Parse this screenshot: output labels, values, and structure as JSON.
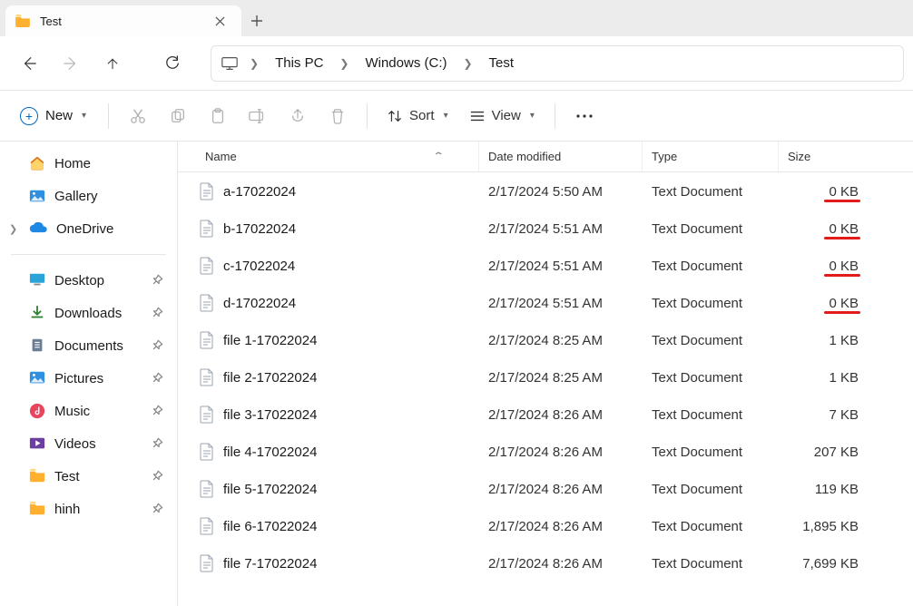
{
  "tab": {
    "title": "Test",
    "close_tooltip": "Close",
    "new_tooltip": "New tab"
  },
  "nav": {
    "back": "Back",
    "forward": "Forward",
    "up": "Up",
    "refresh": "Refresh",
    "breadcrumbs": [
      "This PC",
      "Windows (C:)",
      "Test"
    ]
  },
  "toolbar": {
    "new_label": "New",
    "sort_label": "Sort",
    "view_label": "View",
    "actions": {
      "cut": "Cut",
      "copy": "Copy",
      "paste": "Paste",
      "rename": "Rename",
      "share": "Share",
      "delete": "Delete",
      "more": "More"
    }
  },
  "sidebar": {
    "top": [
      {
        "label": "Home",
        "icon": "home-icon"
      },
      {
        "label": "Gallery",
        "icon": "gallery-icon"
      },
      {
        "label": "OneDrive",
        "icon": "onedrive-icon",
        "expandable": true
      }
    ],
    "bottom": [
      {
        "label": "Desktop",
        "icon": "desktop-icon",
        "pinned": true
      },
      {
        "label": "Downloads",
        "icon": "downloads-icon",
        "pinned": true
      },
      {
        "label": "Documents",
        "icon": "documents-icon",
        "pinned": true
      },
      {
        "label": "Pictures",
        "icon": "pictures-icon",
        "pinned": true
      },
      {
        "label": "Music",
        "icon": "music-icon",
        "pinned": true
      },
      {
        "label": "Videos",
        "icon": "videos-icon",
        "pinned": true
      },
      {
        "label": "Test",
        "icon": "folder-icon",
        "pinned": true
      },
      {
        "label": "hinh",
        "icon": "folder-icon",
        "pinned": true
      }
    ]
  },
  "columns": {
    "name": "Name",
    "date": "Date modified",
    "type": "Type",
    "size": "Size"
  },
  "files": [
    {
      "name": "a-17022024",
      "date": "2/17/2024 5:50 AM",
      "type": "Text Document",
      "size": "0 KB",
      "marked": true
    },
    {
      "name": "b-17022024",
      "date": "2/17/2024 5:51 AM",
      "type": "Text Document",
      "size": "0 KB",
      "marked": true
    },
    {
      "name": "c-17022024",
      "date": "2/17/2024 5:51 AM",
      "type": "Text Document",
      "size": "0 KB",
      "marked": true
    },
    {
      "name": "d-17022024",
      "date": "2/17/2024 5:51 AM",
      "type": "Text Document",
      "size": "0 KB",
      "marked": true
    },
    {
      "name": "file 1-17022024",
      "date": "2/17/2024 8:25 AM",
      "type": "Text Document",
      "size": "1 KB",
      "marked": false
    },
    {
      "name": "file 2-17022024",
      "date": "2/17/2024 8:25 AM",
      "type": "Text Document",
      "size": "1 KB",
      "marked": false
    },
    {
      "name": "file 3-17022024",
      "date": "2/17/2024 8:26 AM",
      "type": "Text Document",
      "size": "7 KB",
      "marked": false
    },
    {
      "name": "file 4-17022024",
      "date": "2/17/2024 8:26 AM",
      "type": "Text Document",
      "size": "207 KB",
      "marked": false
    },
    {
      "name": "file 5-17022024",
      "date": "2/17/2024 8:26 AM",
      "type": "Text Document",
      "size": "119 KB",
      "marked": false
    },
    {
      "name": "file 6-17022024",
      "date": "2/17/2024 8:26 AM",
      "type": "Text Document",
      "size": "1,895 KB",
      "marked": false
    },
    {
      "name": "file 7-17022024",
      "date": "2/17/2024 8:26 AM",
      "type": "Text Document",
      "size": "7,699 KB",
      "marked": false
    }
  ]
}
